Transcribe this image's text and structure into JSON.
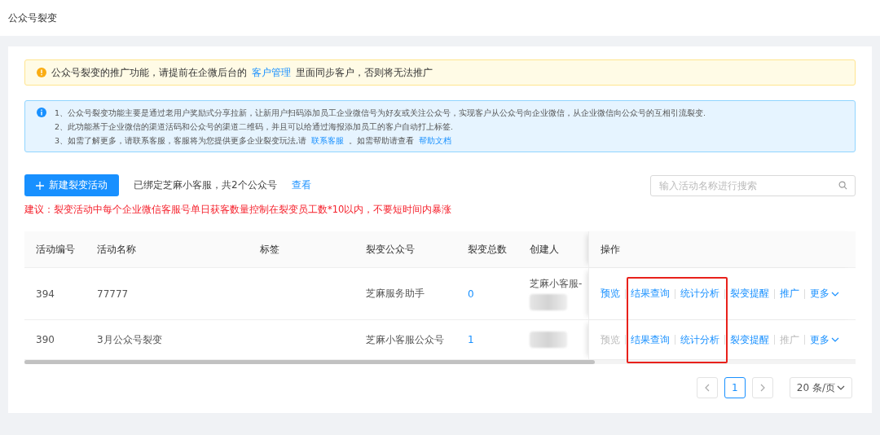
{
  "header": {
    "title": "公众号裂变"
  },
  "warning": {
    "text_before": "公众号裂变的推广功能，请提前在企微后台的",
    "link": "客户管理",
    "text_after": "里面同步客户，否则将无法推广"
  },
  "info": {
    "lines": [
      "1、公众号裂变功能主要是通过老用户奖励式分享拉新，让新用户扫码添加员工企业微信号为好友或关注公众号，实现客户从公众号向企业微信，从企业微信向公众号的互相引流裂变.",
      "2、此功能基于企业微信的渠道活码和公众号的渠道二维码，并且可以给通过海报添加员工的客户自动打上标签."
    ],
    "last_line": "3、如需了解更多，请联系客服，客服将为您提供更多企业裂变玩法,请",
    "contact_link": "联系客服",
    "middle": "。如需帮助请查看",
    "help_link": "帮助文档"
  },
  "toolbar": {
    "new_button": "新建裂变活动",
    "bound_text": "已绑定芝麻小客服，共2个公众号",
    "view_link": "查看",
    "search": {
      "placeholder": "输入活动名称进行搜索"
    }
  },
  "advice": "建议：裂变活动中每个企业微信客服号单日获客数量控制在裂变员工数*10以内，不要短时间内暴涨",
  "table": {
    "columns": [
      "活动编号",
      "活动名称",
      "标签",
      "裂变公众号",
      "裂变总数",
      "创建人",
      "操作"
    ],
    "rows": [
      {
        "id": "394",
        "name": "77777",
        "account": "芝麻服务助手",
        "total": "0",
        "creator": "芝麻小客服-",
        "creator_redacted": true,
        "actions": [
          {
            "label": "预览",
            "disabled": false
          },
          {
            "label": "结果查询",
            "disabled": false
          },
          {
            "label": "统计分析",
            "disabled": false
          },
          {
            "label": "裂变提醒",
            "disabled": false
          },
          {
            "label": "推广",
            "disabled": false
          },
          {
            "label": "更多",
            "disabled": false,
            "kind": "dropdown"
          }
        ]
      },
      {
        "id": "390",
        "name": "3月公众号裂变",
        "account": "芝麻小客服公众号",
        "total": "1",
        "creator_redacted": true,
        "actions": [
          {
            "label": "预览",
            "disabled": true
          },
          {
            "label": "结果查询",
            "disabled": false
          },
          {
            "label": "统计分析",
            "disabled": false
          },
          {
            "label": "裂变提醒",
            "disabled": false
          },
          {
            "label": "推广",
            "disabled": true
          },
          {
            "label": "更多",
            "disabled": false,
            "kind": "dropdown"
          }
        ]
      }
    ]
  },
  "pagination": {
    "pages": [
      {
        "label": "1",
        "selected": true
      }
    ],
    "page_size": "20 条/页"
  }
}
